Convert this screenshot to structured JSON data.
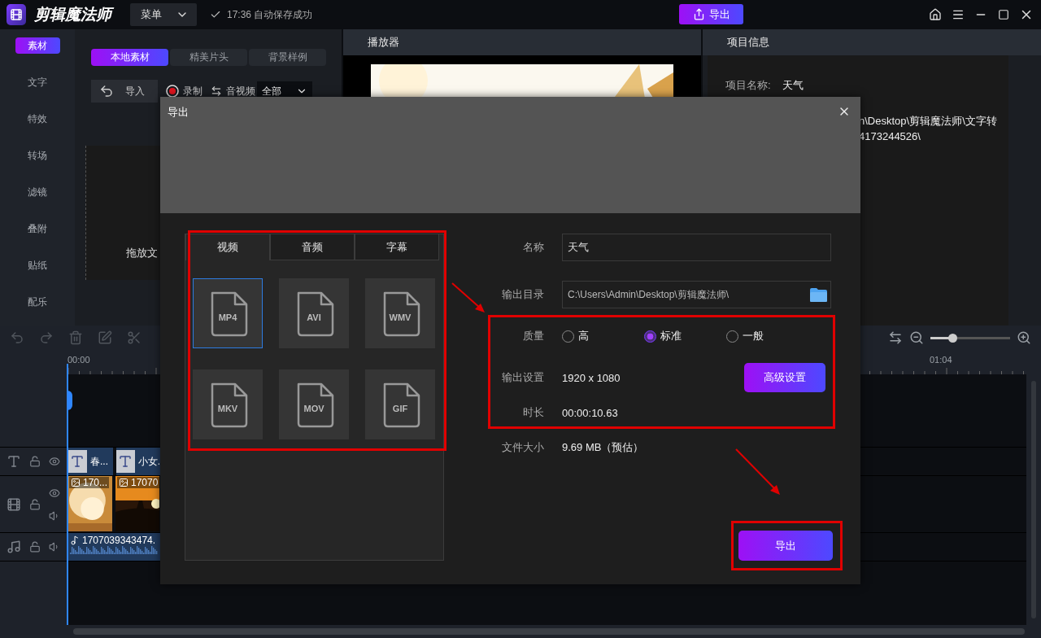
{
  "app": {
    "title": "剪辑魔法师",
    "menu": "菜单",
    "save_status": "17:36 自动保存成功",
    "export_button": "导出"
  },
  "sidebar": {
    "items": [
      {
        "label": "素材",
        "selected": true
      },
      {
        "label": "文字",
        "selected": false
      },
      {
        "label": "特效",
        "selected": false
      },
      {
        "label": "转场",
        "selected": false
      },
      {
        "label": "滤镜",
        "selected": false
      },
      {
        "label": "叠附",
        "selected": false
      },
      {
        "label": "贴纸",
        "selected": false
      },
      {
        "label": "配乐",
        "selected": false
      }
    ]
  },
  "media": {
    "tabs": [
      {
        "label": "本地素材",
        "selected": true
      },
      {
        "label": "精美片头",
        "selected": false
      },
      {
        "label": "背景样例",
        "selected": false
      }
    ],
    "import_button": "导入",
    "record_button": "录制",
    "filter_label": "音视频",
    "filter_value": "全部",
    "drop_hint": "拖放文"
  },
  "player": {
    "title": "播放器"
  },
  "project_info": {
    "title": "项目信息",
    "name_label": "项目名称:",
    "name_value": "天气",
    "path_lines": [
      "n\\Desktop\\剪辑魔法师\\文字转",
      "4173244526\\"
    ]
  },
  "timeline": {
    "zoom": {
      "level": 0.28
    },
    "ruler": [
      "00:00",
      "01:04"
    ],
    "tracks": [
      {
        "kind": "text",
        "clips": [
          {
            "label": "春..."
          },
          {
            "label": "小女."
          }
        ]
      },
      {
        "kind": "video",
        "clips": [
          {
            "label": "170..."
          },
          {
            "label": "17070"
          }
        ]
      },
      {
        "kind": "audio",
        "clips": [
          {
            "label": "1707039343474."
          }
        ]
      }
    ]
  },
  "dialog": {
    "title": "导出",
    "format_tabs": [
      {
        "label": "视频",
        "selected": true
      },
      {
        "label": "音频",
        "selected": false
      },
      {
        "label": "字幕",
        "selected": false
      }
    ],
    "formats": [
      {
        "label": "MP4",
        "selected": true
      },
      {
        "label": "AVI",
        "selected": false
      },
      {
        "label": "WMV",
        "selected": false
      },
      {
        "label": "MKV",
        "selected": false
      },
      {
        "label": "MOV",
        "selected": false
      },
      {
        "label": "GIF",
        "selected": false
      }
    ],
    "name_label": "名称",
    "name_value": "天气",
    "dir_label": "输出目录",
    "dir_value": "C:\\Users\\Admin\\Desktop\\剪辑魔法师\\",
    "quality_label": "质量",
    "quality_options": [
      {
        "label": "高",
        "selected": false
      },
      {
        "label": "标准",
        "selected": true
      },
      {
        "label": "一般",
        "selected": false
      }
    ],
    "settings_label": "输出设置",
    "settings_value": "1920 x 1080",
    "advanced_button": "高级设置",
    "duration_label": "时长",
    "duration_value": "00:00:10.63",
    "size_label": "文件大小",
    "size_value": "9.69 MB（预估）",
    "export_button": "导出"
  }
}
